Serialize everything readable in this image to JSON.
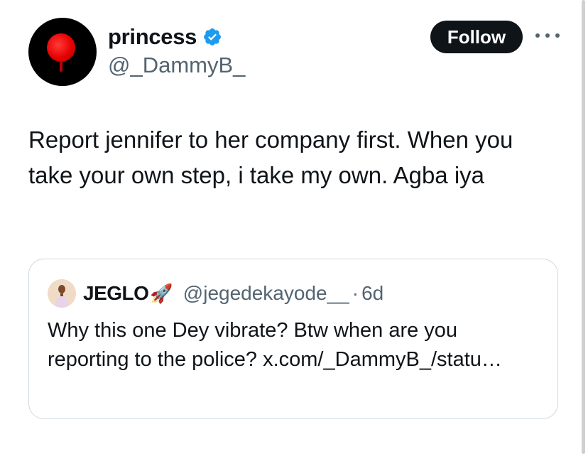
{
  "tweet": {
    "author": {
      "display_name": "princess",
      "handle": "@_DammyB_",
      "verified": true,
      "avatar_icon": "red-circle-avatar"
    },
    "follow_label": "Follow",
    "more_icon": "more-horizontal-icon",
    "text": "Report jennifer to her company first. When you take your own step, i take my own. Agba iya"
  },
  "quote": {
    "author": {
      "display_name": "JEGLO",
      "emoji": "🚀",
      "handle": "@jegedekayode__",
      "separator": "·",
      "time": "6d"
    },
    "text_before_link": "Why this one Dey vibrate? Btw when are you reporting to the police? ",
    "link": "x.com/_DammyB_/statu…"
  },
  "colors": {
    "text": "#0f1419",
    "secondary": "#536471",
    "verified_blue": "#1d9bf0",
    "border": "#cfd9de",
    "follow_bg": "#0f1419"
  }
}
